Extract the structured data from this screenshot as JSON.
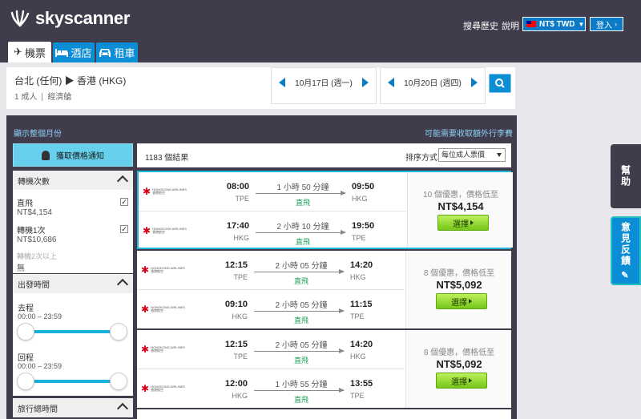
{
  "header": {
    "logo_text": "skyscanner",
    "links": [
      "搜尋歷史",
      "說明"
    ],
    "currency": "NT$ TWD",
    "login_label": "登入",
    "tabs": [
      {
        "label": "機票",
        "icon": "plane-icon",
        "active": true
      },
      {
        "label": "酒店",
        "icon": "bed-icon",
        "active": false
      },
      {
        "label": "租車",
        "icon": "car-icon",
        "active": false
      }
    ]
  },
  "search": {
    "route": "台北 (任何) ▶ 香港 (HKG)",
    "passengers": "1 成人",
    "cabin": "經濟艙",
    "depart_date": "10月17日 (週一)",
    "return_date": "10月20日 (週四)"
  },
  "panel": {
    "month_link": "顯示整個月份",
    "baggage_link": "可能需要收取額外行李費",
    "alert_label": "獲取價格通知"
  },
  "filters": {
    "stops_title": "轉機次數",
    "stops": [
      {
        "label": "直飛",
        "price": "NT$4,154",
        "checked": true,
        "enabled": true
      },
      {
        "label": "轉機1次",
        "price": "NT$10,686",
        "checked": true,
        "enabled": true
      },
      {
        "label": "轉機2次以上",
        "price": "無",
        "checked": false,
        "enabled": false
      }
    ],
    "times_title": "出發時間",
    "outbound_label": "去程",
    "outbound_range": "00:00 – 23:59",
    "return_label": "回程",
    "return_range": "00:00 – 23:59",
    "duration_title": "旅行總時間"
  },
  "results": {
    "count": "1183 個結果",
    "sort_label": "排序方式",
    "sort_value": "每位成人票價",
    "select_label": "選擇",
    "airline_name": "HONGKONG AIRLINES 香港航空",
    "items": [
      {
        "legs": [
          {
            "dep_time": "08:00",
            "dep_ap": "TPE",
            "duration": "1 小時 50 分鐘",
            "direct": "直飛",
            "arr_time": "09:50",
            "arr_ap": "HKG"
          },
          {
            "dep_time": "17:40",
            "dep_ap": "HKG",
            "duration": "2 小時 10 分鐘",
            "direct": "直飛",
            "arr_time": "19:50",
            "arr_ap": "TPE"
          }
        ],
        "deals": "10 個優惠，價格低至",
        "price": "NT$4,154"
      },
      {
        "legs": [
          {
            "dep_time": "12:15",
            "dep_ap": "TPE",
            "duration": "2 小時 05 分鐘",
            "direct": "直飛",
            "arr_time": "14:20",
            "arr_ap": "HKG"
          },
          {
            "dep_time": "09:10",
            "dep_ap": "HKG",
            "duration": "2 小時 05 分鐘",
            "direct": "直飛",
            "arr_time": "11:15",
            "arr_ap": "TPE"
          }
        ],
        "deals": "8 個優惠，價格低至",
        "price": "NT$5,092"
      },
      {
        "legs": [
          {
            "dep_time": "12:15",
            "dep_ap": "TPE",
            "duration": "2 小時 05 分鐘",
            "direct": "直飛",
            "arr_time": "14:20",
            "arr_ap": "HKG"
          },
          {
            "dep_time": "12:00",
            "dep_ap": "HKG",
            "duration": "1 小時 55 分鐘",
            "direct": "直飛",
            "arr_time": "13:55",
            "arr_ap": "TPE"
          }
        ],
        "deals": "8 個優惠，價格低至",
        "price": "NT$5,092"
      }
    ]
  },
  "side_tabs": {
    "help": "幫助",
    "feedback": "意見反饋"
  },
  "colors": {
    "header_bg": "#403c4b",
    "accent_blue": "#0b8ed6",
    "select_green": "#76c619",
    "slider_blue": "#1ab0dc"
  }
}
